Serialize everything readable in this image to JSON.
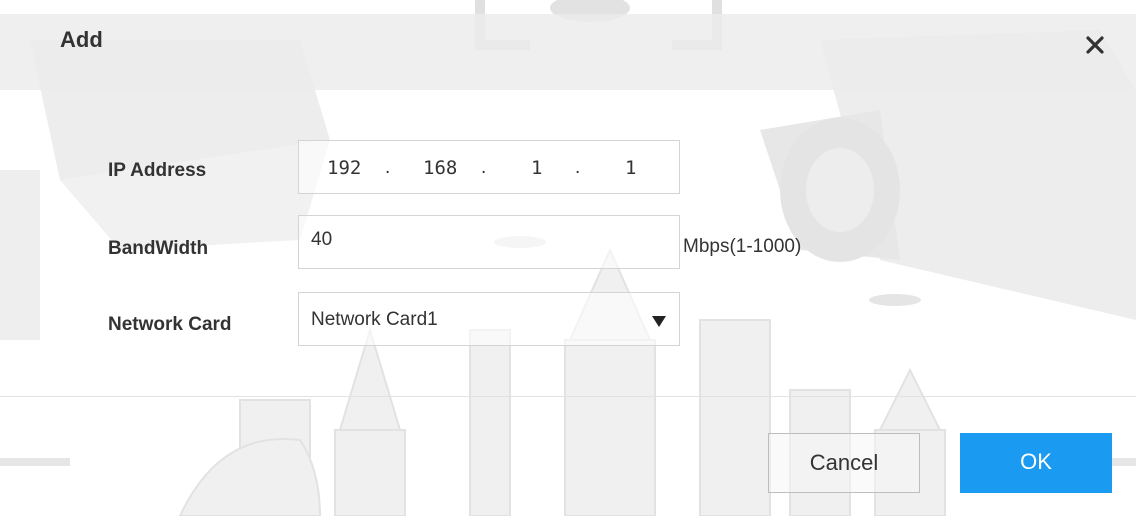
{
  "dialog": {
    "title": "Add",
    "close_icon": "close-icon"
  },
  "form": {
    "ip_address": {
      "label": "IP Address",
      "octets": [
        "192",
        "168",
        "1",
        "1"
      ]
    },
    "bandwidth": {
      "label": "BandWidth",
      "value": "40",
      "unit": "Mbps(1-1000)"
    },
    "network_card": {
      "label": "Network Card",
      "selected": "Network Card1",
      "dropdown_icon": "dropdown-triangle-icon"
    }
  },
  "buttons": {
    "cancel": "Cancel",
    "ok": "OK"
  },
  "colors": {
    "ok_button": "#1a9af0",
    "header_bg": "#ececec"
  }
}
